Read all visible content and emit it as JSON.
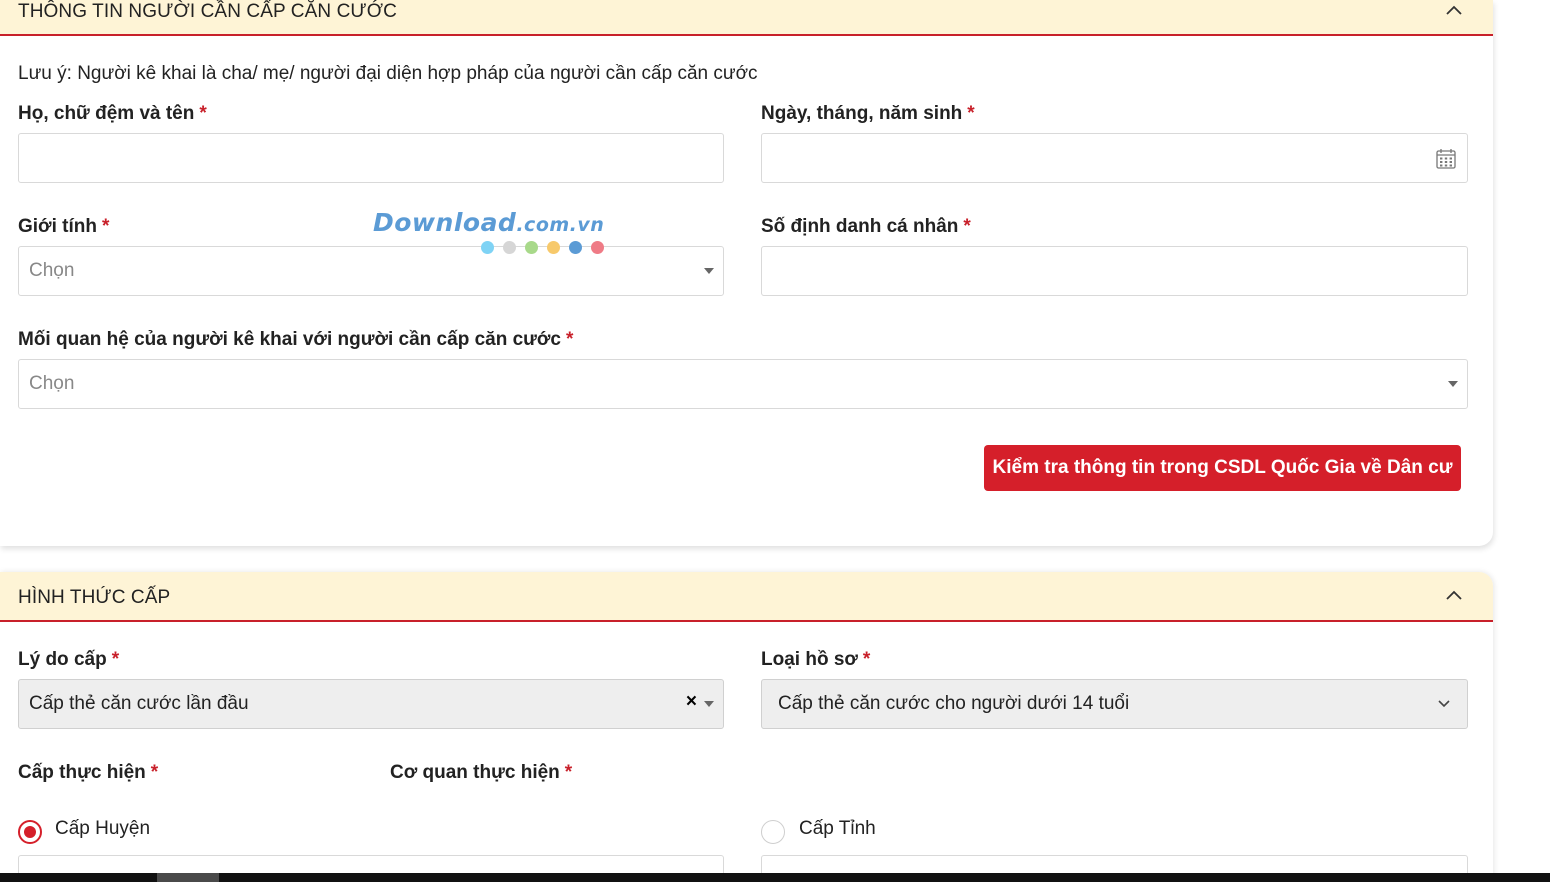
{
  "section1": {
    "title": "THÔNG TIN NGƯỜI CẦN CẤP CĂN CƯỚC",
    "note": "Lưu ý: Người kê khai là cha/ mẹ/ người đại diện hợp pháp của người cần cấp căn cước",
    "required_mark": "*",
    "full_name": {
      "label": "Họ, chữ đệm và tên",
      "value": ""
    },
    "dob": {
      "label": "Ngày, tháng, năm sinh",
      "value": ""
    },
    "gender": {
      "label": "Giới tính",
      "placeholder": "Chọn"
    },
    "personal_id": {
      "label": "Số định danh cá nhân",
      "value": ""
    },
    "relationship": {
      "label": "Mối quan hệ của người kê khai với người cần cấp căn cước",
      "placeholder": "Chọn"
    },
    "check_button": "Kiểm tra thông tin trong CSDL Quốc Gia về Dân cư"
  },
  "section2": {
    "title": "HÌNH THỨC CẤP",
    "reason": {
      "label": "Lý do cấp",
      "value": "Cấp thẻ căn cước lần đầu",
      "clear": "×"
    },
    "record_type": {
      "label": "Loại hồ sơ",
      "value": "Cấp thẻ căn cước cho người dưới 14 tuổi"
    },
    "level": {
      "label": "Cấp thực hiện"
    },
    "agency": {
      "label": "Cơ quan thực hiện"
    },
    "options": [
      {
        "label": "Cấp Huyện",
        "selected": true
      },
      {
        "label": "Cấp Tỉnh",
        "selected": false
      }
    ]
  },
  "watermark": {
    "text_main": "Download",
    "text_suffix": ".com.vn",
    "dot_colors": [
      "#7fd3f5",
      "#d6d6d6",
      "#a8d98a",
      "#f7c96b",
      "#5b9bd5",
      "#ef7b86"
    ]
  },
  "colors": {
    "accent": "#d51f2a",
    "header_bg": "#fef4d6",
    "field_disabled_bg": "#eeeeee"
  }
}
